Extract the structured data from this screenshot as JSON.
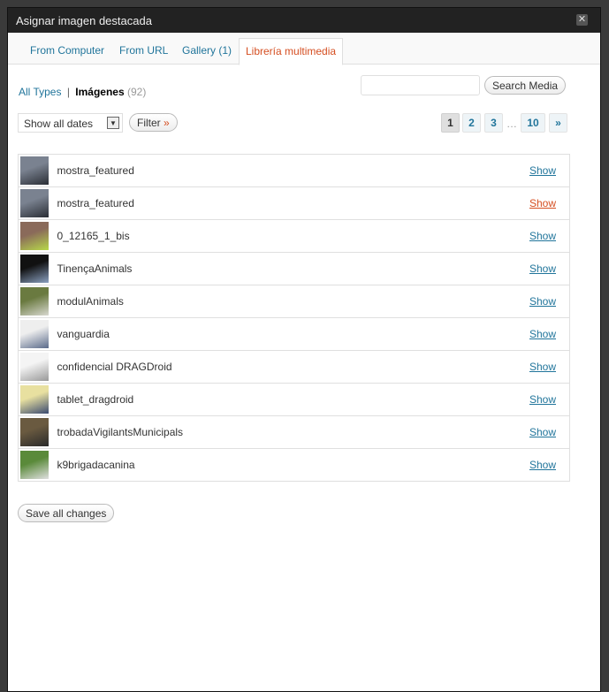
{
  "title": "Asignar imagen destacada",
  "close_icon": "close-icon",
  "tabs": [
    {
      "label": "From Computer"
    },
    {
      "label": "From URL"
    },
    {
      "label": "Gallery (1)"
    },
    {
      "label": "Librería multimedia",
      "active": true
    }
  ],
  "filter": {
    "all_types": "All Types",
    "sep": "|",
    "images": "Imágenes",
    "count": "(92)"
  },
  "search": {
    "value": "",
    "button": "Search Media"
  },
  "dates": {
    "selected": "Show all dates",
    "filter_button": "Filter",
    "filter_arrow": "»"
  },
  "pagination": {
    "pages": [
      "1",
      "2",
      "3"
    ],
    "ellipsis": "…",
    "last": "10",
    "next": "»",
    "current": "1"
  },
  "items": [
    {
      "name": "mostra_featured",
      "action": "Show",
      "thumb": [
        "#7a8290",
        "#2a2e35"
      ]
    },
    {
      "name": "mostra_featured",
      "action": "Show",
      "thumb": [
        "#7a8290",
        "#2a2e35"
      ]
    },
    {
      "name": "0_12165_1_bis",
      "action": "Show",
      "thumb": [
        "#8a6a5a",
        "#b7d84a"
      ]
    },
    {
      "name": "TinençaAnimals",
      "action": "Show",
      "thumb": [
        "#111111",
        "#8aa0c0"
      ]
    },
    {
      "name": "modulAnimals",
      "action": "Show",
      "thumb": [
        "#6a7a40",
        "#d8d8d0"
      ]
    },
    {
      "name": "vanguardia",
      "action": "Show",
      "thumb": [
        "#eeeeee",
        "#5a6a8a"
      ]
    },
    {
      "name": "confidencial DRAGDroid",
      "action": "Show",
      "thumb": [
        "#f4f4f4",
        "#999999"
      ]
    },
    {
      "name": "tablet_dragdroid",
      "action": "Show",
      "thumb": [
        "#e8e0a0",
        "#3a4a70"
      ]
    },
    {
      "name": "trobadaVigilantsMunicipals",
      "action": "Show",
      "thumb": [
        "#6a5a40",
        "#2a2a2a"
      ]
    },
    {
      "name": "k9brigadacanina",
      "action": "Show",
      "thumb": [
        "#5a8a3a",
        "#e0e0e0"
      ]
    }
  ],
  "save_all": "Save all changes"
}
